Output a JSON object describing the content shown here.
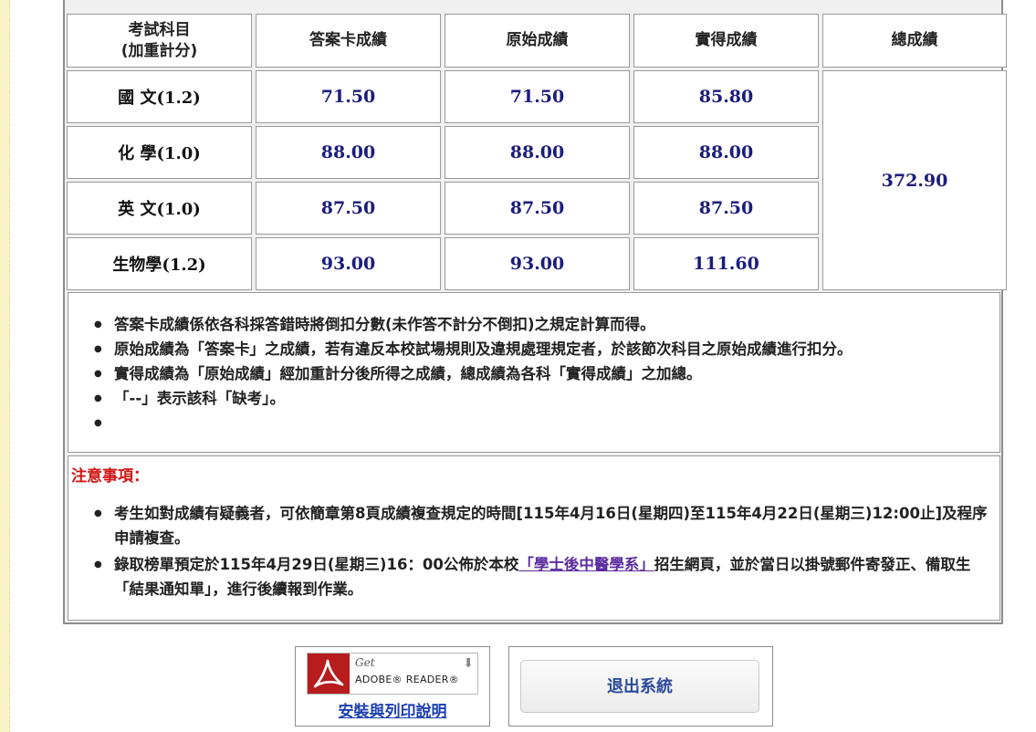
{
  "table": {
    "headers": {
      "subject_line1": "考試科目",
      "subject_line2": "(加重計分)",
      "answer_card": "答案卡成績",
      "raw": "原始成績",
      "actual": "實得成績",
      "total": "總成績"
    },
    "rows": [
      {
        "subject_cn": "國 文",
        "weight": "(1.2)",
        "answer_card": "71.50",
        "raw": "71.50",
        "actual": "85.80"
      },
      {
        "subject_cn": "化 學",
        "weight": "(1.0)",
        "answer_card": "88.00",
        "raw": "88.00",
        "actual": "88.00"
      },
      {
        "subject_cn": "英 文",
        "weight": "(1.0)",
        "answer_card": "87.50",
        "raw": "87.50",
        "actual": "87.50"
      },
      {
        "subject_cn": "生物學",
        "weight": "(1.2)",
        "answer_card": "93.00",
        "raw": "93.00",
        "actual": "111.60"
      }
    ],
    "total": "372.90"
  },
  "notes": [
    "答案卡成績係依各科採答錯時將倒扣分數(未作答不計分不倒扣)之規定計算而得。",
    "原始成績為「答案卡」之成績，若有違反本校試場規則及違規處理規定者，於該節次科目之原始成績進行扣分。",
    "實得成績為「原始成績」經加重計分後所得之成績，總成績為各科「實得成績」之加總。",
    "「--」表示該科「缺考」。",
    ""
  ],
  "caution": {
    "title": "注意事項：",
    "item1": "考生如對成績有疑義者，可依簡章第8頁成績複查規定的時間[115年4月16日(星期四)至115年4月22日(星期三)12:00止]及程序申請複查。",
    "item2_before": "錄取榜單預定於115年4月29日(星期三)16：00公佈於本校",
    "item2_link": "「學士後中醫學系」",
    "item2_after": "招生網頁，並於當日以掛號郵件寄發正、備取生「結果通知單」，進行後續報到作業。"
  },
  "adobe": {
    "badge_get": "Get",
    "badge_name": "ADOBE® READER®",
    "link": "安裝與列印說明"
  },
  "exit_button": "退出系統"
}
